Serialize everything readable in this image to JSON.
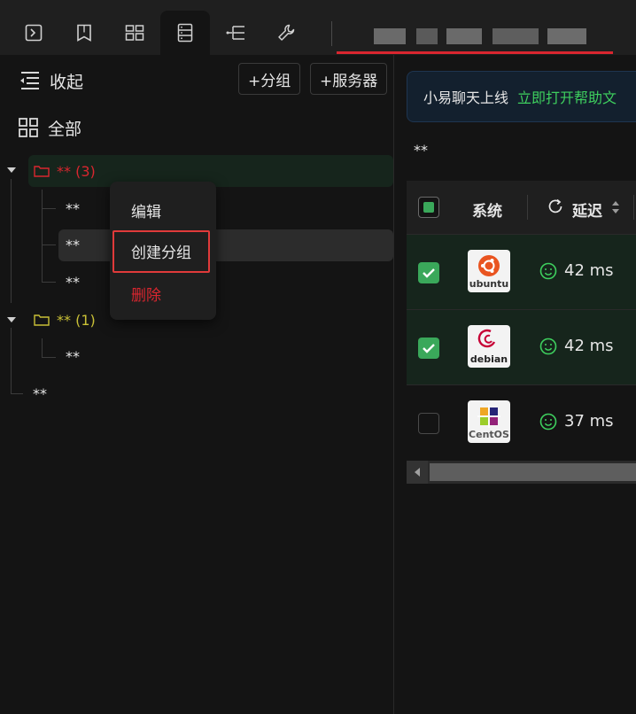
{
  "toolbar": {
    "icons": [
      "terminal-icon",
      "bookmark-icon",
      "dashboard-icon",
      "server-list-icon",
      "tree-sftp-icon",
      "wrench-icon"
    ],
    "active_index": 3,
    "tab_accent": "#d9262f"
  },
  "sidebar": {
    "collapse_label": "收起",
    "all_label": "全部",
    "add_group_button": "+分组",
    "add_server_button": "+服务器",
    "groups": [
      {
        "label": "** (3)",
        "color": "#d9262f",
        "children": [
          "**",
          "**",
          "**"
        ]
      },
      {
        "label": "** (1)",
        "color": "#c9c036",
        "children": [
          "**"
        ]
      }
    ],
    "ungrouped": [
      "**"
    ]
  },
  "context_menu": {
    "edit": "编辑",
    "create_group": "创建分组",
    "delete": "删除"
  },
  "notice": {
    "text": "小易聊天上线",
    "link": "立即打开帮助文"
  },
  "breadcrumb": "**",
  "table": {
    "columns": {
      "system": "系统",
      "latency": "延迟"
    },
    "rows": [
      {
        "selected": true,
        "os": "ubuntu",
        "latency": "42 ms"
      },
      {
        "selected": true,
        "os": "debian",
        "latency": "42 ms"
      },
      {
        "selected": false,
        "os": "CentOS",
        "latency": "37 ms"
      }
    ]
  },
  "colors": {
    "success": "#3ecf5e",
    "checkbox": "#3aa85a",
    "danger": "#d9262f",
    "warn": "#c9c036"
  }
}
